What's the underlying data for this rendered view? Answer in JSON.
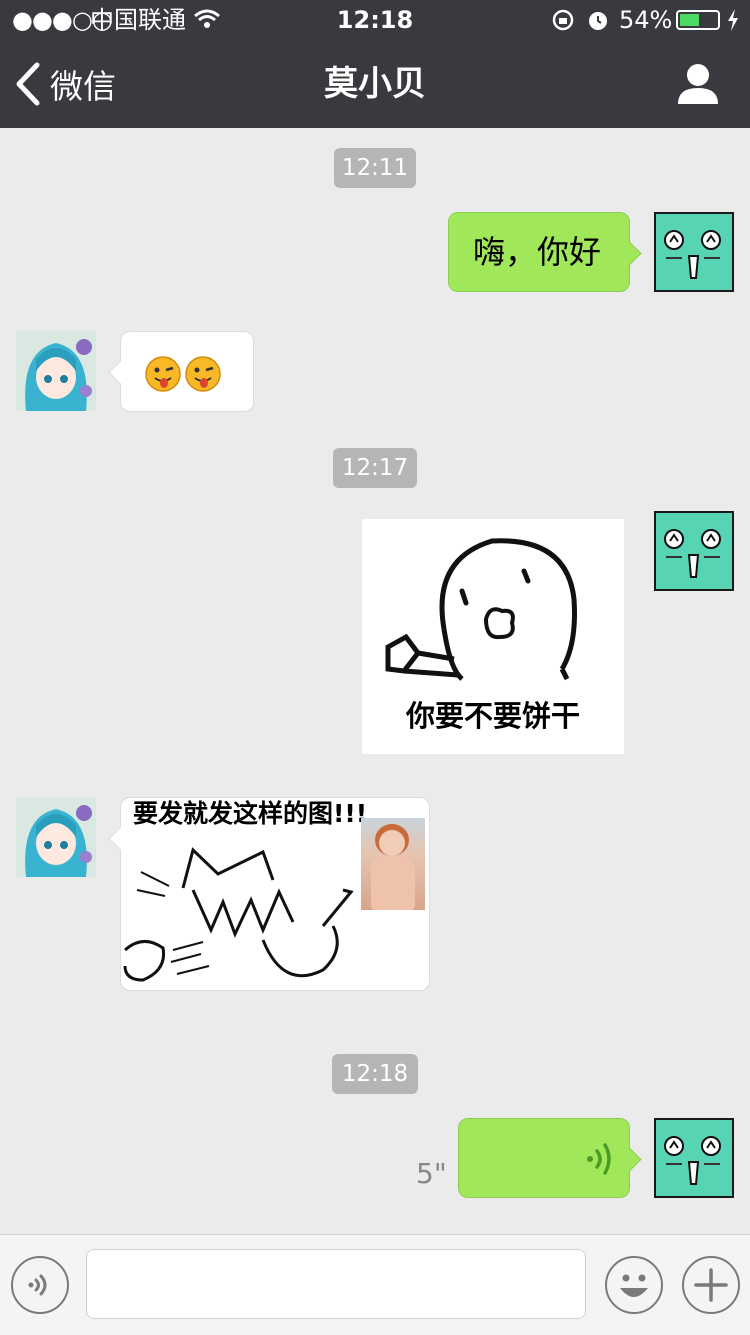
{
  "status_bar": {
    "signal": "●●●○○",
    "carrier": "中国联通",
    "time": "12:18",
    "battery": "54%",
    "battery_level": 0.54
  },
  "nav": {
    "back_label": "微信",
    "title": "莫小贝"
  },
  "messages": {
    "time1": "12:11",
    "msg1": "嗨，你好",
    "time2": "12:17",
    "sticker1_caption": "你要不要饼干",
    "sticker2_caption": "要发就发这样的图!!!",
    "time3": "12:18",
    "voice_duration": "5\""
  },
  "colors": {
    "bar": "#393a3f",
    "my_bubble": "#a0e75a",
    "chat_bg": "#ebebeb"
  }
}
